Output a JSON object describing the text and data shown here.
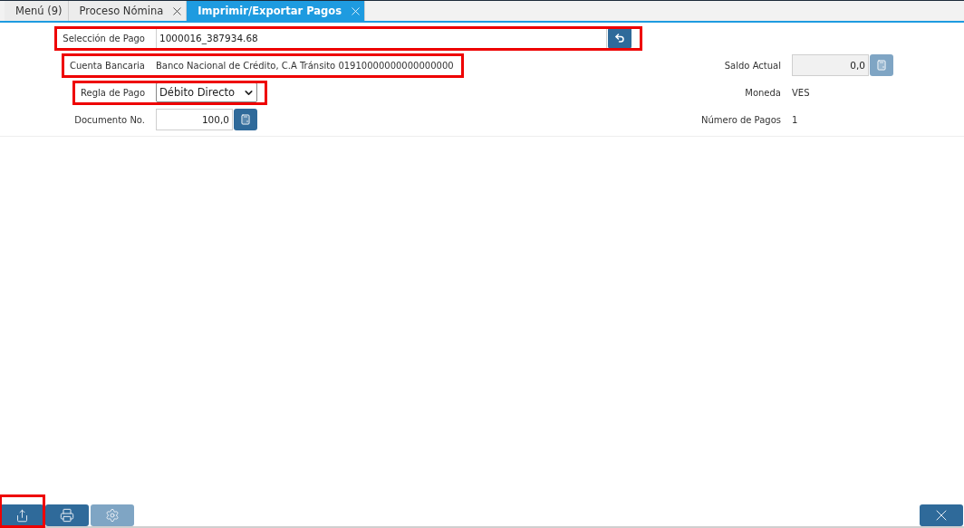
{
  "tabs": [
    {
      "label": "Menú (9)",
      "closable": false,
      "selected": false
    },
    {
      "label": "Proceso Nómina",
      "closable": true,
      "selected": false
    },
    {
      "label": "Imprimir/Exportar Pagos",
      "closable": true,
      "selected": true
    }
  ],
  "left_fields": [
    {
      "kind": "search",
      "label": "Selección de Pago",
      "value": "1000016_387934.68",
      "highlighted": true
    },
    {
      "kind": "text",
      "label": "Cuenta Bancaria",
      "value": "Banco Nacional de Crédito, C.A Tránsito 01910000000000000000",
      "highlighted": true
    },
    {
      "kind": "select",
      "label": "Regla de Pago",
      "value": "Débito Directo",
      "highlighted": true
    },
    {
      "kind": "number",
      "label": "Documento No.",
      "value": "100,0",
      "disabled": false,
      "highlighted": false
    }
  ],
  "right_fields": [
    {
      "kind": "number",
      "label": "Saldo Actual",
      "value": "0,0",
      "disabled": true
    },
    {
      "kind": "text",
      "label": "Moneda",
      "value": "VES"
    },
    {
      "kind": "text",
      "label": "Número de Pagos",
      "value": "1"
    }
  ],
  "toolbar": [
    {
      "kind": "export",
      "disabled": false,
      "highlighted": true
    },
    {
      "kind": "print",
      "disabled": false,
      "highlighted": false
    },
    {
      "kind": "settings",
      "disabled": true,
      "highlighted": false
    }
  ],
  "close_button": {
    "kind": "close",
    "disabled": false
  }
}
